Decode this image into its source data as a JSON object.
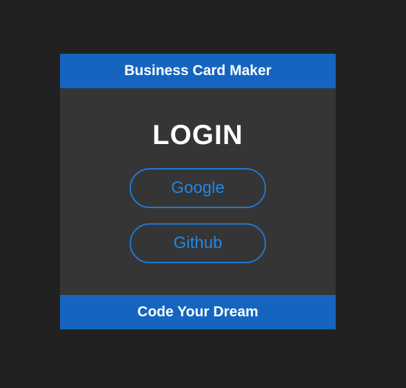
{
  "header": {
    "title": "Business Card Maker"
  },
  "main": {
    "heading": "LOGIN",
    "buttons": [
      {
        "label": "Google"
      },
      {
        "label": "Github"
      }
    ]
  },
  "footer": {
    "text": "Code Your Dream"
  },
  "colors": {
    "background": "#212121",
    "card": "#353535",
    "accent": "#1565c0",
    "button_border": "#1e7ad6",
    "button_text": "#1e88e5"
  }
}
